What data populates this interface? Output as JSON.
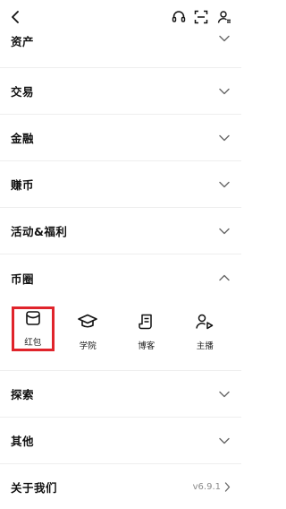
{
  "top_icons": [
    "back-arrow-icon",
    "headset-icon",
    "scan-icon",
    "user-settings-icon"
  ],
  "rows": [
    {
      "label": "资产"
    },
    {
      "label": "交易"
    },
    {
      "label": "金融"
    },
    {
      "label": "赚币"
    },
    {
      "label": "活动&福利"
    },
    {
      "label": "币圈"
    },
    {
      "label": "探索"
    },
    {
      "label": "其他"
    }
  ],
  "coin_tiles": [
    {
      "label": "红包",
      "icon": "red-packet-icon",
      "selected": true
    },
    {
      "label": "学院",
      "icon": "graduation-cap-icon"
    },
    {
      "label": "博客",
      "icon": "blog-icon"
    },
    {
      "label": "主播",
      "icon": "streamer-icon"
    }
  ],
  "about": {
    "label": "关于我们",
    "version": "v6.9.1"
  },
  "colors": {
    "highlight": "#e0242b",
    "text": "#111111",
    "divider": "#eeeeee"
  }
}
